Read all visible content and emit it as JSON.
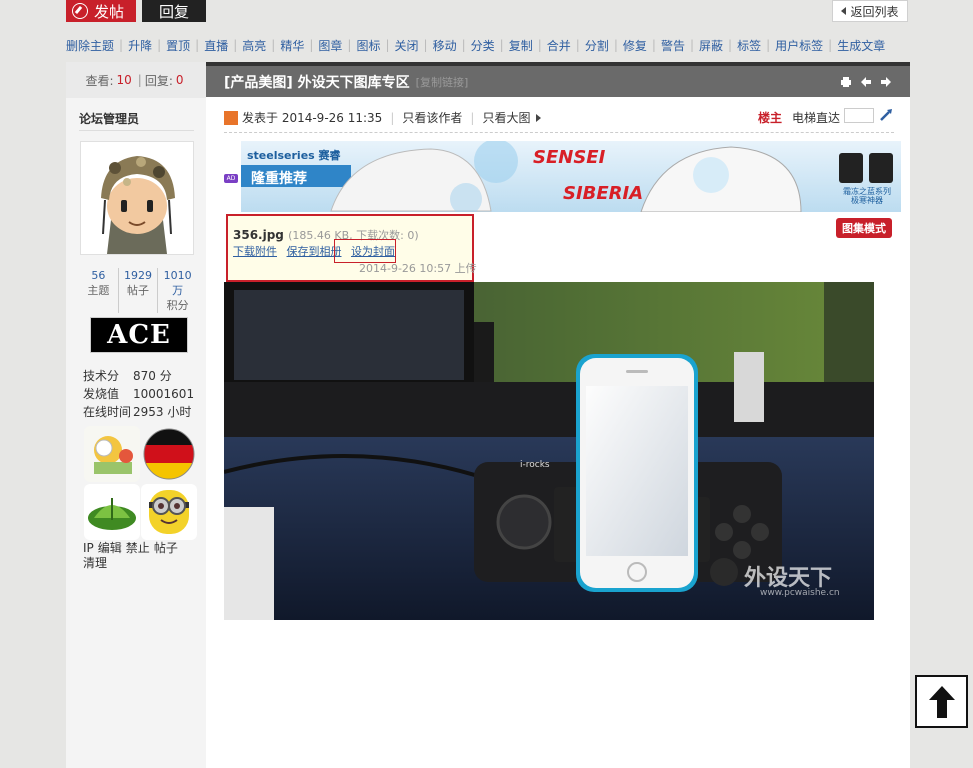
{
  "top": {
    "post_label": "发帖",
    "reply_label": "回复",
    "back_label": "返回列表"
  },
  "admin_actions": [
    "删除主题",
    "升降",
    "置顶",
    "直播",
    "高亮",
    "精华",
    "图章",
    "图标",
    "关闭",
    "移动",
    "分类",
    "复制",
    "合并",
    "分割",
    "修复",
    "警告",
    "屏蔽",
    "标签",
    "用户标签",
    "生成文章"
  ],
  "thread_stats": {
    "views_label": "查看:",
    "views": "10",
    "sep": "|",
    "replies_label": "回复:",
    "replies": "0"
  },
  "author": {
    "name": "论坛管理员",
    "stats": [
      {
        "num": "56",
        "label": "主题"
      },
      {
        "num": "1929",
        "label": "帖子"
      },
      {
        "num": "1010万",
        "label": "积分"
      }
    ],
    "badge_text": "ACE",
    "details": [
      {
        "key": "技术分",
        "value": "870 分"
      },
      {
        "key": "发烧值",
        "value": "10001601"
      },
      {
        "key": "在线时间",
        "value": "2953 小时"
      }
    ],
    "tools": [
      "IP",
      "编辑",
      "禁止",
      "帖子",
      "清理"
    ]
  },
  "thread": {
    "title": "[产品美图] 外设天下图库专区",
    "copy_link": "[复制链接]"
  },
  "post": {
    "posted_at": "发表于 2014-9-26 11:35",
    "only_author": "只看该作者",
    "only_big": "只看大图",
    "floor": "楼主",
    "elevator": "电梯直达"
  },
  "ad": {
    "brand": "steelseries 赛睿",
    "slogan": "隆重推荐",
    "product1": "SENSEI",
    "product2": "SIBERIA",
    "caption1": "霜冻之蓝系列",
    "caption2": "极寒神器",
    "tag": "AD"
  },
  "attachment": {
    "filename": "356.jpg",
    "meta": "(185.46 KB, 下载次数: 0)",
    "download": "下载附件",
    "save_album": "保存到相册",
    "set_cover": "设为封面",
    "uploaded": "2014-9-26 10:57 上传"
  },
  "gallery_mode": "图集模式",
  "photo": {
    "device_label": "i-rocks",
    "watermark": "外设天下",
    "watermark_url": "www.pcwaishe.cn"
  }
}
